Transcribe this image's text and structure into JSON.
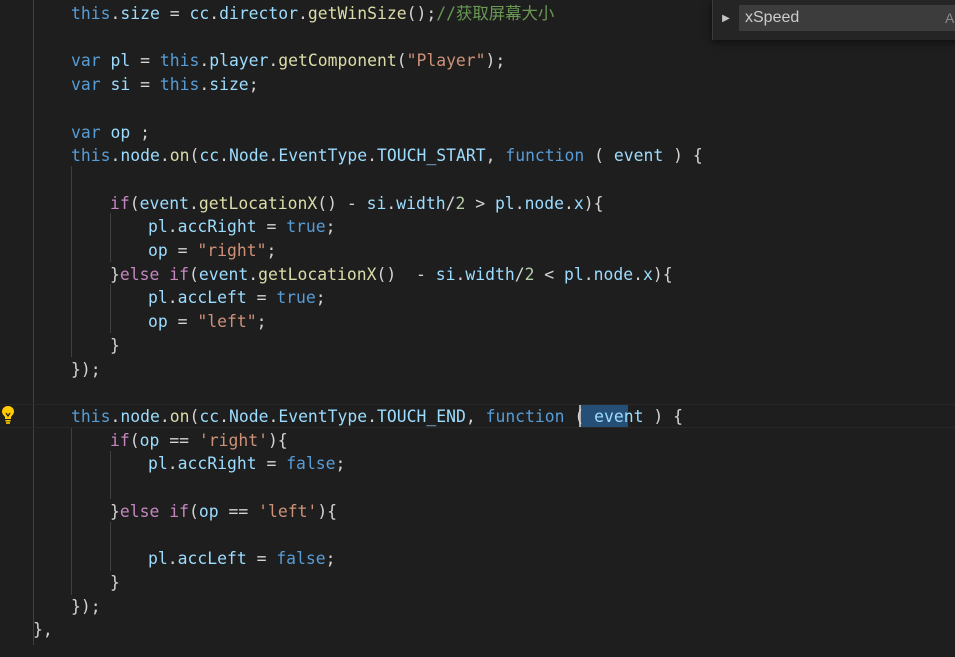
{
  "find_widget": {
    "expand_icon": "chevron-right",
    "query": "xSpeed",
    "match_case_label": "A"
  },
  "editor": {
    "lightbulb_icon": "lightbulb",
    "colors": {
      "background": "#1e1e1e",
      "keyword": "#569cd6",
      "control": "#c586c0",
      "variable": "#9cdcfe",
      "function": "#dcdcaa",
      "type": "#4ec9b0",
      "string": "#ce9178",
      "number": "#b5cea8",
      "comment": "#6a9955",
      "plain": "#d4d4d4"
    },
    "lines": [
      {
        "tokens": [
          {
            "t": "this",
            "c": "kw"
          },
          {
            "t": ".",
            "c": "pl"
          },
          {
            "t": "size",
            "c": "var"
          },
          {
            "t": " = ",
            "c": "pl"
          },
          {
            "t": "cc",
            "c": "var"
          },
          {
            "t": ".",
            "c": "pl"
          },
          {
            "t": "director",
            "c": "var"
          },
          {
            "t": ".",
            "c": "pl"
          },
          {
            "t": "getWinSize",
            "c": "fn"
          },
          {
            "t": "();",
            "c": "pl"
          },
          {
            "t": "//获取屏幕大小",
            "c": "cm"
          }
        ]
      },
      {
        "tokens": []
      },
      {
        "tokens": [
          {
            "t": "var",
            "c": "kw"
          },
          {
            "t": " ",
            "c": "pl"
          },
          {
            "t": "pl",
            "c": "var"
          },
          {
            "t": " = ",
            "c": "pl"
          },
          {
            "t": "this",
            "c": "kw"
          },
          {
            "t": ".",
            "c": "pl"
          },
          {
            "t": "player",
            "c": "var"
          },
          {
            "t": ".",
            "c": "pl"
          },
          {
            "t": "getComponent",
            "c": "fn"
          },
          {
            "t": "(",
            "c": "pl"
          },
          {
            "t": "\"Player\"",
            "c": "str"
          },
          {
            "t": ");",
            "c": "pl"
          }
        ]
      },
      {
        "tokens": [
          {
            "t": "var",
            "c": "kw"
          },
          {
            "t": " ",
            "c": "pl"
          },
          {
            "t": "si",
            "c": "var"
          },
          {
            "t": " = ",
            "c": "pl"
          },
          {
            "t": "this",
            "c": "kw"
          },
          {
            "t": ".",
            "c": "pl"
          },
          {
            "t": "size",
            "c": "var"
          },
          {
            "t": ";",
            "c": "pl"
          }
        ]
      },
      {
        "tokens": []
      },
      {
        "tokens": [
          {
            "t": "var",
            "c": "kw"
          },
          {
            "t": " ",
            "c": "pl"
          },
          {
            "t": "op",
            "c": "var"
          },
          {
            "t": " ;",
            "c": "pl"
          }
        ]
      },
      {
        "tokens": [
          {
            "t": "this",
            "c": "kw"
          },
          {
            "t": ".",
            "c": "pl"
          },
          {
            "t": "node",
            "c": "var"
          },
          {
            "t": ".",
            "c": "pl"
          },
          {
            "t": "on",
            "c": "fn"
          },
          {
            "t": "(",
            "c": "pl"
          },
          {
            "t": "cc",
            "c": "var"
          },
          {
            "t": ".",
            "c": "pl"
          },
          {
            "t": "Node",
            "c": "var"
          },
          {
            "t": ".",
            "c": "pl"
          },
          {
            "t": "EventType",
            "c": "var"
          },
          {
            "t": ".",
            "c": "pl"
          },
          {
            "t": "TOUCH_START",
            "c": "var"
          },
          {
            "t": ", ",
            "c": "pl"
          },
          {
            "t": "function",
            "c": "kw"
          },
          {
            "t": " ( ",
            "c": "pl"
          },
          {
            "t": "event",
            "c": "var"
          },
          {
            "t": " ) {",
            "c": "pl"
          }
        ]
      },
      {
        "tokens": []
      },
      {
        "tokens": [
          {
            "t": "if",
            "c": "ctl"
          },
          {
            "t": "(",
            "c": "pl"
          },
          {
            "t": "event",
            "c": "var"
          },
          {
            "t": ".",
            "c": "pl"
          },
          {
            "t": "getLocationX",
            "c": "fn"
          },
          {
            "t": "() - ",
            "c": "pl"
          },
          {
            "t": "si",
            "c": "var"
          },
          {
            "t": ".",
            "c": "pl"
          },
          {
            "t": "width",
            "c": "var"
          },
          {
            "t": "/",
            "c": "pl"
          },
          {
            "t": "2",
            "c": "num"
          },
          {
            "t": " > ",
            "c": "pl"
          },
          {
            "t": "pl",
            "c": "var"
          },
          {
            "t": ".",
            "c": "pl"
          },
          {
            "t": "node",
            "c": "var"
          },
          {
            "t": ".",
            "c": "pl"
          },
          {
            "t": "x",
            "c": "var"
          },
          {
            "t": "){",
            "c": "pl"
          }
        ]
      },
      {
        "tokens": [
          {
            "t": "pl",
            "c": "var"
          },
          {
            "t": ".",
            "c": "pl"
          },
          {
            "t": "accRight",
            "c": "var"
          },
          {
            "t": " = ",
            "c": "pl"
          },
          {
            "t": "true",
            "c": "kw"
          },
          {
            "t": ";",
            "c": "pl"
          }
        ]
      },
      {
        "tokens": [
          {
            "t": "op",
            "c": "var"
          },
          {
            "t": " = ",
            "c": "pl"
          },
          {
            "t": "\"right\"",
            "c": "str"
          },
          {
            "t": ";",
            "c": "pl"
          }
        ]
      },
      {
        "tokens": [
          {
            "t": "}",
            "c": "pl"
          },
          {
            "t": "else",
            "c": "ctl"
          },
          {
            "t": " ",
            "c": "pl"
          },
          {
            "t": "if",
            "c": "ctl"
          },
          {
            "t": "(",
            "c": "pl"
          },
          {
            "t": "event",
            "c": "var"
          },
          {
            "t": ".",
            "c": "pl"
          },
          {
            "t": "getLocationX",
            "c": "fn"
          },
          {
            "t": "()  - ",
            "c": "pl"
          },
          {
            "t": "si",
            "c": "var"
          },
          {
            "t": ".",
            "c": "pl"
          },
          {
            "t": "width",
            "c": "var"
          },
          {
            "t": "/",
            "c": "pl"
          },
          {
            "t": "2",
            "c": "num"
          },
          {
            "t": " < ",
            "c": "pl"
          },
          {
            "t": "pl",
            "c": "var"
          },
          {
            "t": ".",
            "c": "pl"
          },
          {
            "t": "node",
            "c": "var"
          },
          {
            "t": ".",
            "c": "pl"
          },
          {
            "t": "x",
            "c": "var"
          },
          {
            "t": "){",
            "c": "pl"
          }
        ]
      },
      {
        "tokens": [
          {
            "t": "pl",
            "c": "var"
          },
          {
            "t": ".",
            "c": "pl"
          },
          {
            "t": "accLeft",
            "c": "var"
          },
          {
            "t": " = ",
            "c": "pl"
          },
          {
            "t": "true",
            "c": "kw"
          },
          {
            "t": ";",
            "c": "pl"
          }
        ]
      },
      {
        "tokens": [
          {
            "t": "op",
            "c": "var"
          },
          {
            "t": " = ",
            "c": "pl"
          },
          {
            "t": "\"left\"",
            "c": "str"
          },
          {
            "t": ";",
            "c": "pl"
          }
        ]
      },
      {
        "tokens": [
          {
            "t": "}",
            "c": "pl"
          }
        ]
      },
      {
        "tokens": [
          {
            "t": "});",
            "c": "pl"
          }
        ]
      },
      {
        "tokens": []
      },
      {
        "tokens": [
          {
            "t": "this",
            "c": "kw"
          },
          {
            "t": ".",
            "c": "pl"
          },
          {
            "t": "node",
            "c": "var"
          },
          {
            "t": ".",
            "c": "pl"
          },
          {
            "t": "on",
            "c": "fn"
          },
          {
            "t": "(",
            "c": "pl"
          },
          {
            "t": "cc",
            "c": "var"
          },
          {
            "t": ".",
            "c": "pl"
          },
          {
            "t": "Node",
            "c": "var"
          },
          {
            "t": ".",
            "c": "pl"
          },
          {
            "t": "EventType",
            "c": "var"
          },
          {
            "t": ".",
            "c": "pl"
          },
          {
            "t": "TOUCH_END",
            "c": "var"
          },
          {
            "t": ", ",
            "c": "pl"
          },
          {
            "t": "function",
            "c": "kw"
          },
          {
            "t": " ( ",
            "c": "pl"
          },
          {
            "t": "event",
            "c": "var"
          },
          {
            "t": " ) {",
            "c": "pl"
          }
        ]
      },
      {
        "tokens": [
          {
            "t": "if",
            "c": "ctl"
          },
          {
            "t": "(",
            "c": "pl"
          },
          {
            "t": "op",
            "c": "var"
          },
          {
            "t": " == ",
            "c": "pl"
          },
          {
            "t": "'right'",
            "c": "str"
          },
          {
            "t": "){",
            "c": "pl"
          }
        ]
      },
      {
        "tokens": [
          {
            "t": "pl",
            "c": "var"
          },
          {
            "t": ".",
            "c": "pl"
          },
          {
            "t": "accRight",
            "c": "var"
          },
          {
            "t": " = ",
            "c": "pl"
          },
          {
            "t": "false",
            "c": "kw"
          },
          {
            "t": ";",
            "c": "pl"
          }
        ]
      },
      {
        "tokens": []
      },
      {
        "tokens": [
          {
            "t": "}",
            "c": "pl"
          },
          {
            "t": "else",
            "c": "ctl"
          },
          {
            "t": " ",
            "c": "pl"
          },
          {
            "t": "if",
            "c": "ctl"
          },
          {
            "t": "(",
            "c": "pl"
          },
          {
            "t": "op",
            "c": "var"
          },
          {
            "t": " == ",
            "c": "pl"
          },
          {
            "t": "'left'",
            "c": "str"
          },
          {
            "t": "){",
            "c": "pl"
          }
        ]
      },
      {
        "tokens": []
      },
      {
        "tokens": [
          {
            "t": "pl",
            "c": "var"
          },
          {
            "t": ".",
            "c": "pl"
          },
          {
            "t": "accLeft",
            "c": "var"
          },
          {
            "t": " = ",
            "c": "pl"
          },
          {
            "t": "false",
            "c": "kw"
          },
          {
            "t": ";",
            "c": "pl"
          }
        ]
      },
      {
        "tokens": [
          {
            "t": "}",
            "c": "pl"
          }
        ]
      },
      {
        "tokens": [
          {
            "t": "});",
            "c": "pl"
          }
        ]
      },
      {
        "tokens": [
          {
            "t": "},",
            "c": "pl"
          }
        ]
      }
    ]
  }
}
